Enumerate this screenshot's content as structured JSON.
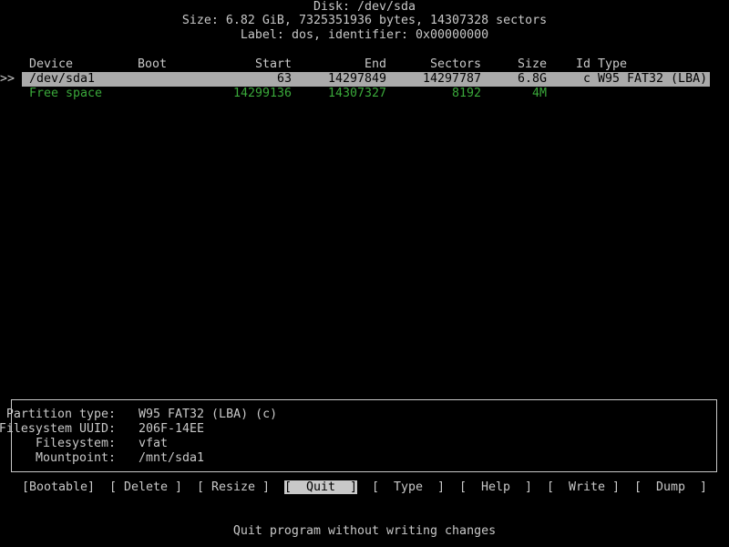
{
  "header": {
    "disk": "Disk: /dev/sda",
    "size": "Size: 6.82 GiB, 7325351936 bytes, 14307328 sectors",
    "label": "Label: dos, identifier: 0x00000000"
  },
  "table": {
    "columns": {
      "device": "Device",
      "boot": "Boot",
      "start": "Start",
      "end": "End",
      "sectors": "Sectors",
      "size": "Size",
      "id": "Id",
      "type": "Type"
    },
    "selector": ">>",
    "rows": [
      {
        "device": "/dev/sda1",
        "boot": "",
        "start": "63",
        "end": "14297849",
        "sectors": "14297787",
        "size": "6.8G",
        "id": "c",
        "type": "W95 FAT32 (LBA)"
      },
      {
        "device": "Free space",
        "boot": "",
        "start": "14299136",
        "end": "14307327",
        "sectors": "8192",
        "size": "4M",
        "id": "",
        "type": ""
      }
    ]
  },
  "info": {
    "partition_type_label": "Partition type:",
    "partition_type_value": "W95 FAT32 (LBA) (c)",
    "fs_uuid_label": "Filesystem UUID:",
    "fs_uuid_value": "206F-14EE",
    "filesystem_label": "Filesystem:",
    "filesystem_value": "vfat",
    "mountpoint_label": "Mountpoint:",
    "mountpoint_value": "/mnt/sda1"
  },
  "menu": {
    "bootable": "[Bootable]",
    "delete": "[ Delete ]",
    "resize": "[ Resize ]",
    "quit": "[  Quit  ]",
    "type": "[  Type  ]",
    "help": "[  Help  ]",
    "write": "[  Write ]",
    "dump": "[  Dump  ]",
    "active": "quit"
  },
  "status": "Quit program without writing changes",
  "colors": {
    "background": "#000000",
    "foreground": "#c8c8c8",
    "selected_row_bg": "#aaaaaa",
    "free_space": "#3aa83a"
  }
}
